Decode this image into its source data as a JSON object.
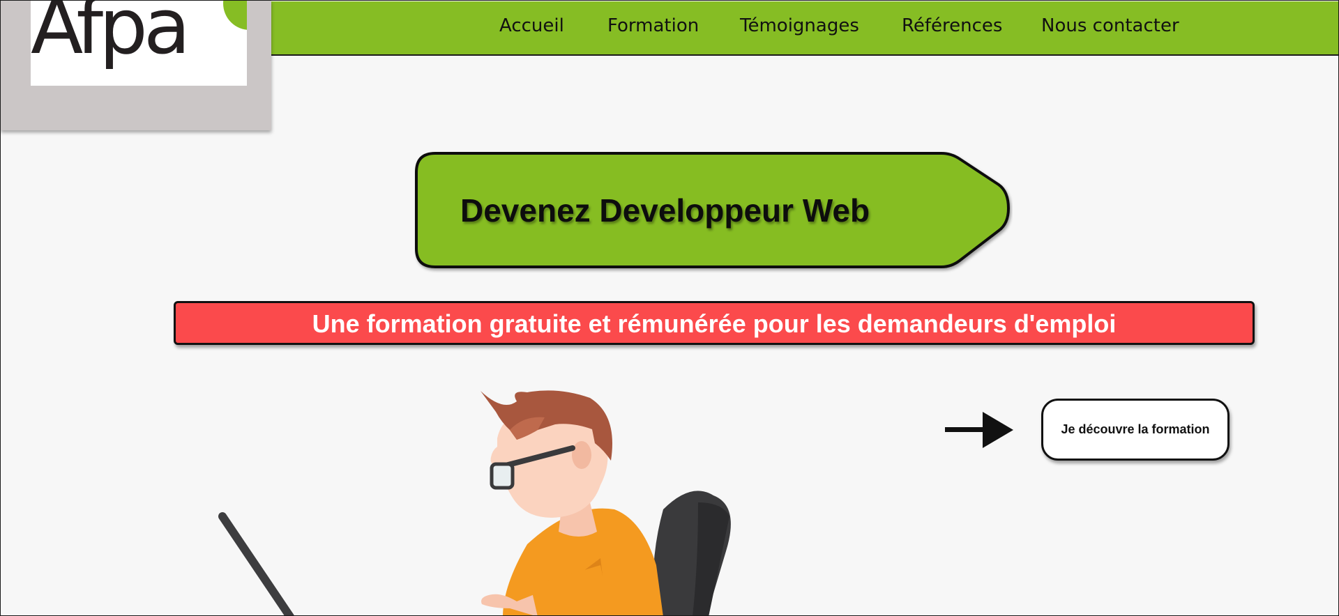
{
  "logo": {
    "text": "Afpa"
  },
  "nav": {
    "items": [
      {
        "label": "Accueil"
      },
      {
        "label": "Formation"
      },
      {
        "label": "Témoignages"
      },
      {
        "label": "Références"
      },
      {
        "label": "Nous contacter"
      }
    ]
  },
  "hero": {
    "title": "Devenez Developpeur Web",
    "subtitle": "Une formation gratuite et rémunérée pour les demandeurs d'emploi",
    "cta_label": "Je découvre la formation"
  },
  "colors": {
    "brand_green": "#86bd24",
    "banner_red": "#fb4a4c",
    "logo_panel": "#cbc6c6",
    "background": "#f7f7f7"
  },
  "icons": {
    "arrow": "arrow-right-icon",
    "illustration": "developer-illustration"
  }
}
